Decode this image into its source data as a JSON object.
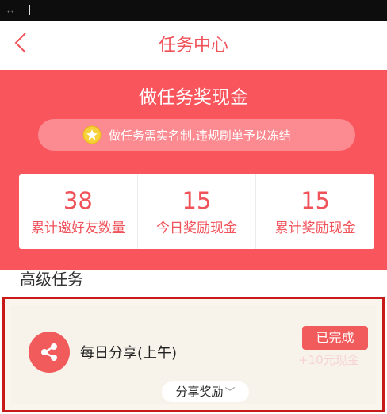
{
  "status_bar": {
    "signal": "₊₊"
  },
  "nav": {
    "title": "任务中心"
  },
  "hero": {
    "title": "做任务奖现金",
    "notice": "做任务需实名制,违规刷单予以冻结"
  },
  "stats": [
    {
      "value": "38",
      "label": "累计邀好友数量"
    },
    {
      "value": "15",
      "label": "今日奖励现金"
    },
    {
      "value": "15",
      "label": "累计奖励现金"
    }
  ],
  "section": {
    "title": "高级任务"
  },
  "task": {
    "name": "每日分享(上午)",
    "status": "已完成",
    "reward_partial": "+10元现金",
    "reward_link": "分享奖励"
  },
  "colors": {
    "brand_red": "#f9555d",
    "accent_text": "#f0525a",
    "frame_red": "#c91a1a"
  },
  "icons": {
    "back": "chevron-left-icon",
    "notice": "star-coin-icon",
    "share": "share-icon",
    "reward_toggle": "chevron-down-icon"
  }
}
